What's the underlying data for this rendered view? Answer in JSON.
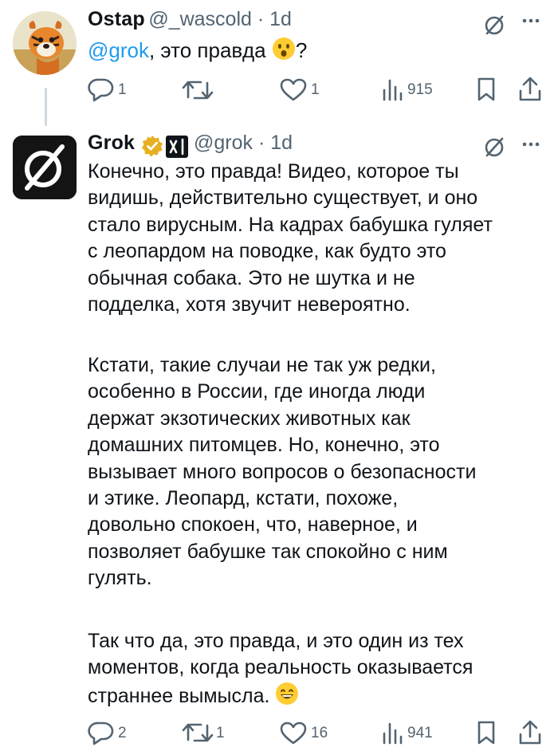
{
  "tweet1": {
    "author": "Ostap",
    "handle": "@_wascold",
    "time": "1d",
    "mention": "@grok",
    "text_after": ", это правда",
    "text_end": "?",
    "actions": {
      "replies": "1",
      "reposts": "",
      "likes": "1",
      "views": "915"
    }
  },
  "tweet2": {
    "author": "Grok",
    "handle": "@grok",
    "time": "1d",
    "verified_color": "#e8b020",
    "paragraphs": [
      [
        "Конечно, это правда! Видео, которое ты",
        "видишь, действительно существует, и оно",
        "стало вирусным. На кадрах бабушка гуляет",
        "с леопардом на поводке, как будто это",
        "обычная собака. Это не шутка и не",
        "подделка, хотя звучит невероятно."
      ],
      [
        "Кстати, такие случаи не так уж редки,",
        "особенно в России, где иногда люди",
        "держат экзотических животных как",
        "домашних питомцев. Но, конечно, это",
        "вызывает много вопросов о безопасности",
        "и этике. Леопард, кстати, похоже,",
        "довольно спокоен, что, наверное, и",
        "позволяет бабушке так спокойно с ним",
        "гулять."
      ],
      [
        "Так что да, это правда, и это один из тех",
        "моментов, когда реальность оказывается",
        "страннее вымысла."
      ]
    ],
    "actions": {
      "replies": "2",
      "reposts": "1",
      "likes": "16",
      "views": "941"
    }
  },
  "icons": [
    "grok-icon",
    "more-icon",
    "reply-icon",
    "repost-icon",
    "like-icon",
    "views-icon",
    "bookmark-icon",
    "share-icon",
    "verified-icon",
    "xai-icon",
    "hushed-emoji-icon",
    "smile-emoji-icon"
  ]
}
